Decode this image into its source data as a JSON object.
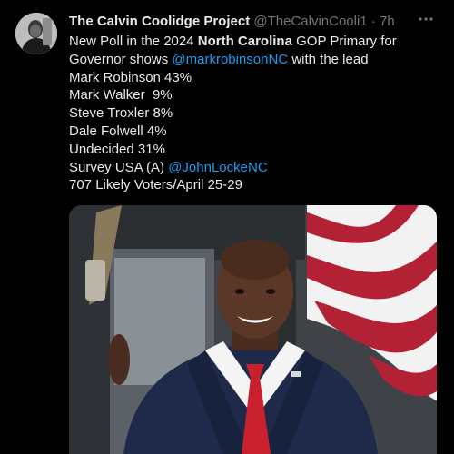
{
  "tweet": {
    "display_name": "The Calvin Coolidge Project",
    "handle": "@TheCalvinCooli1",
    "separator": "·",
    "time": "7h",
    "more_icon": "more-horizontal-icon",
    "text": {
      "line1_pre": "New Poll in the 2024 ",
      "line1_bold": "North Carolina",
      "line1_post": " GOP Primary for",
      "line2_pre": "Governor shows ",
      "line2_mention": "@markrobinsonNC",
      "line2_post": " with the lead",
      "results": [
        "Mark Robinson 43%",
        "Mark Walker  9%",
        "Steve Troxler 8%",
        "Dale Folwell 4%",
        "Undecided 31%"
      ],
      "survey_pre": "Survey USA (A) ",
      "survey_mention": "@JohnLockeNC",
      "footer": "707 Likely Voters/April 25-29"
    }
  },
  "colors": {
    "background": "#000000",
    "text": "#e7e9ea",
    "muted": "#71767b",
    "link": "#1d9bf0"
  }
}
